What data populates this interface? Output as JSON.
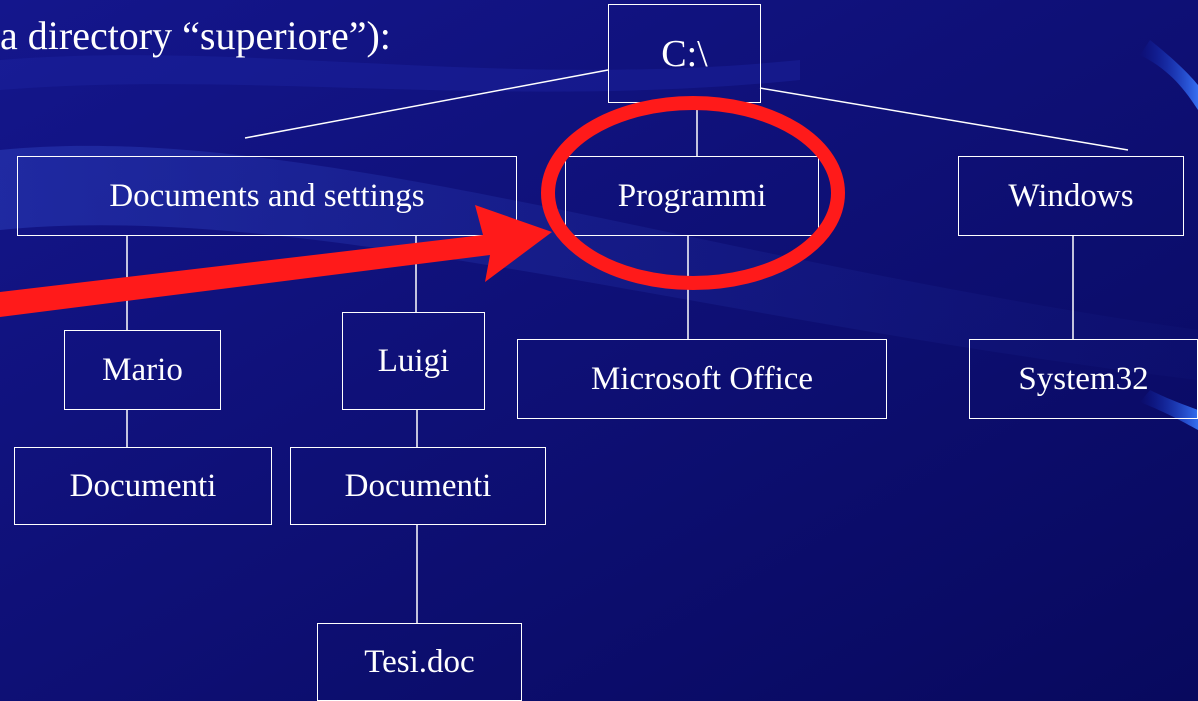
{
  "caption": "a directory “superiore”):",
  "nodes": {
    "root": "C:\\",
    "documents_and_settings": "Documents and settings",
    "programmi": "Programmi",
    "windows": "Windows",
    "mario": "Mario",
    "luigi": "Luigi",
    "microsoft_office": "Microsoft Office",
    "system32": "System32",
    "documenti_mario": "Documenti",
    "documenti_luigi": "Documenti",
    "tesi": "Tesi.doc"
  },
  "colors": {
    "background": "#0d0f7a",
    "lines": "#ffffff",
    "highlight": "#ff1a1a"
  }
}
